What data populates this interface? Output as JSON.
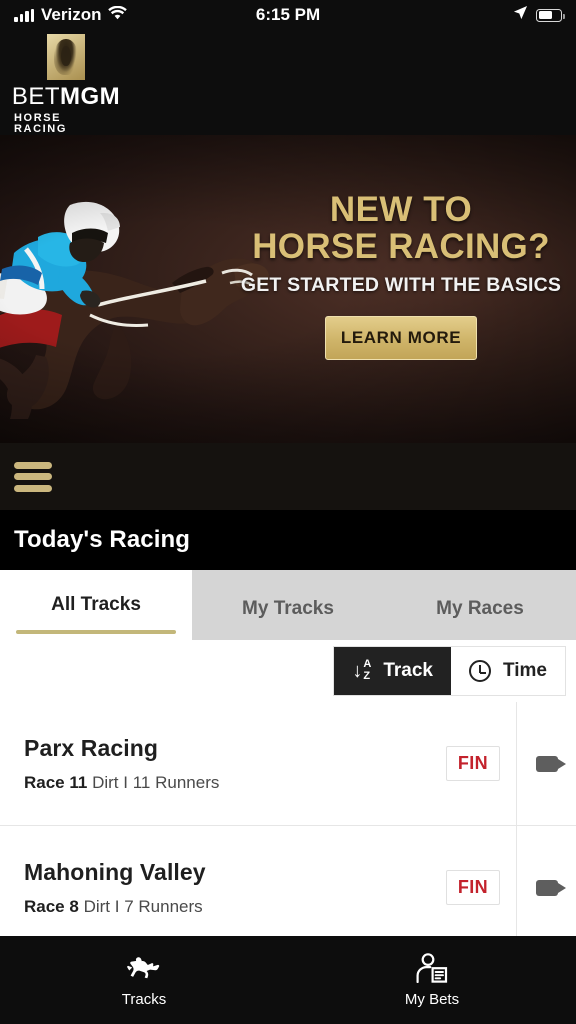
{
  "status_bar": {
    "carrier": "Verizon",
    "time": "6:15 PM",
    "signal_icon": "cellular-bars-icon",
    "wifi_icon": "wifi-icon",
    "location_icon": "location-arrow-icon",
    "battery_icon": "battery-icon"
  },
  "brand": {
    "logo_icon": "betmgm-lion-icon",
    "name_thin": "BET",
    "name_bold": "MGM",
    "tagline": "HORSE RACING"
  },
  "banner": {
    "image_name": "jockey-on-racehorse-photo",
    "line1": "NEW TO",
    "line2": "HORSE RACING?",
    "subline": "GET STARTED WITH THE BASICS",
    "cta_label": "LEARN MORE"
  },
  "menu": {
    "hamburger_icon": "hamburger-menu-icon"
  },
  "header": {
    "title": "Today's Racing"
  },
  "tabs": [
    {
      "label": "All Tracks",
      "active": true
    },
    {
      "label": "My Tracks",
      "active": false
    },
    {
      "label": "My Races",
      "active": false
    }
  ],
  "sort": {
    "track_label": "Track",
    "track_icon": "sort-alpha-down-icon",
    "track_icon_letters": [
      "A",
      "Z"
    ],
    "track_icon_arrow": "↓",
    "time_label": "Time",
    "time_icon": "clock-icon",
    "active": "Track"
  },
  "races": [
    {
      "track": "Parx Racing",
      "race_label": "Race 11",
      "surface": "Dirt",
      "separator": "I",
      "runners": "11 Runners",
      "status": "FIN",
      "video_icon": "video-camera-icon"
    },
    {
      "track": "Mahoning Valley",
      "race_label": "Race 8",
      "surface": "Dirt",
      "separator": "I",
      "runners": "7 Runners",
      "status": "FIN",
      "video_icon": "video-camera-icon"
    }
  ],
  "bottom_nav": [
    {
      "label": "Tracks",
      "icon": "racehorse-jockey-icon"
    },
    {
      "label": "My Bets",
      "icon": "person-with-betslip-icon"
    }
  ],
  "colors": {
    "gold": "#c3b77a",
    "logo_gold": "#cbb77e",
    "banner_gold": "#d9bf76",
    "status_red": "#c3222c",
    "dark": "#0d0d0d"
  }
}
